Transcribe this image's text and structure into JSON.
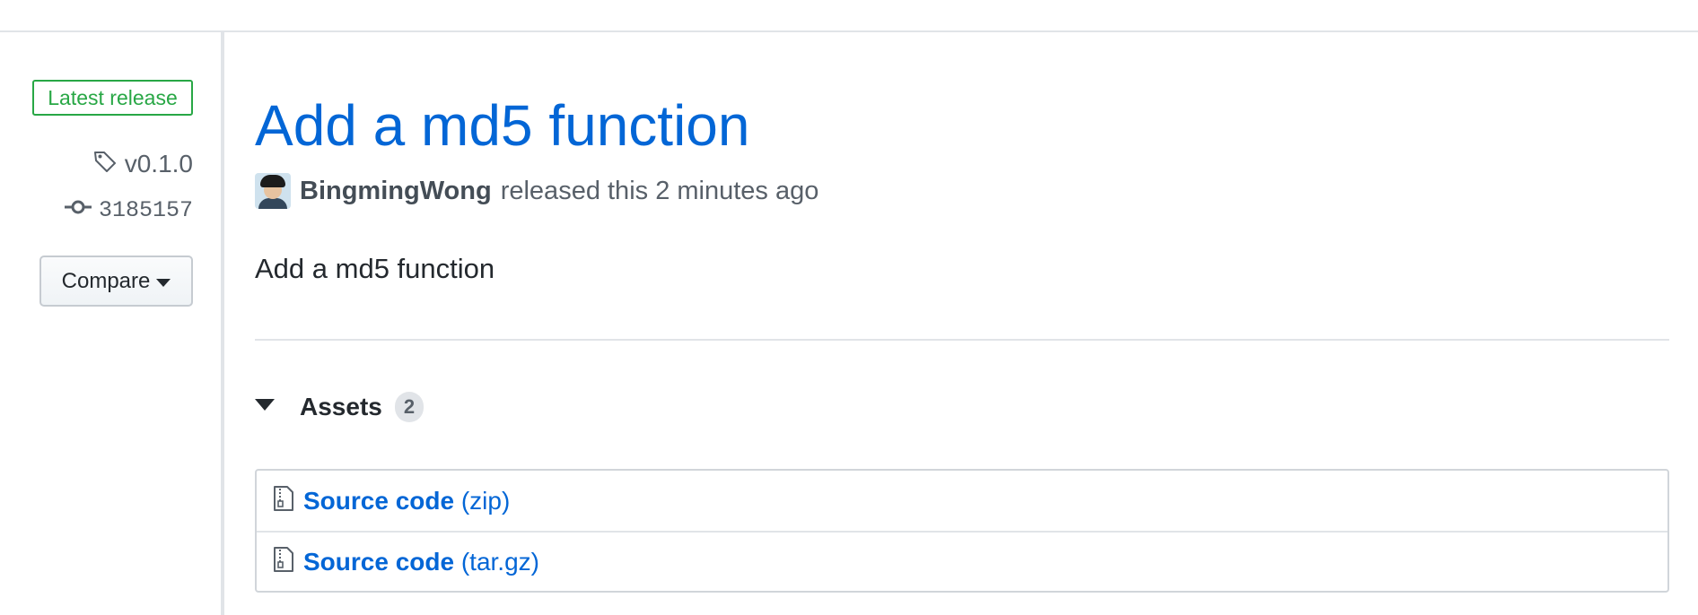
{
  "sidebar": {
    "latest_label": "Latest release",
    "tag": "v0.1.0",
    "commit": "3185157",
    "compare_label": "Compare"
  },
  "release": {
    "title": "Add a md5 function",
    "author": "BingmingWong",
    "released_text": "released this 2 minutes ago",
    "body": "Add a md5 function"
  },
  "assets": {
    "title": "Assets",
    "count": "2",
    "items": [
      {
        "name": "Source code",
        "ext": "(zip)"
      },
      {
        "name": "Source code",
        "ext": "(tar.gz)"
      }
    ]
  },
  "icons": {
    "tag": "tag-icon",
    "commit": "git-commit-icon",
    "caret": "triangle-down-icon",
    "archive": "file-zip-icon"
  },
  "colors": {
    "link": "#0366d6",
    "latest_green": "#28a745",
    "muted": "#586069",
    "border": "#e1e4e8"
  }
}
